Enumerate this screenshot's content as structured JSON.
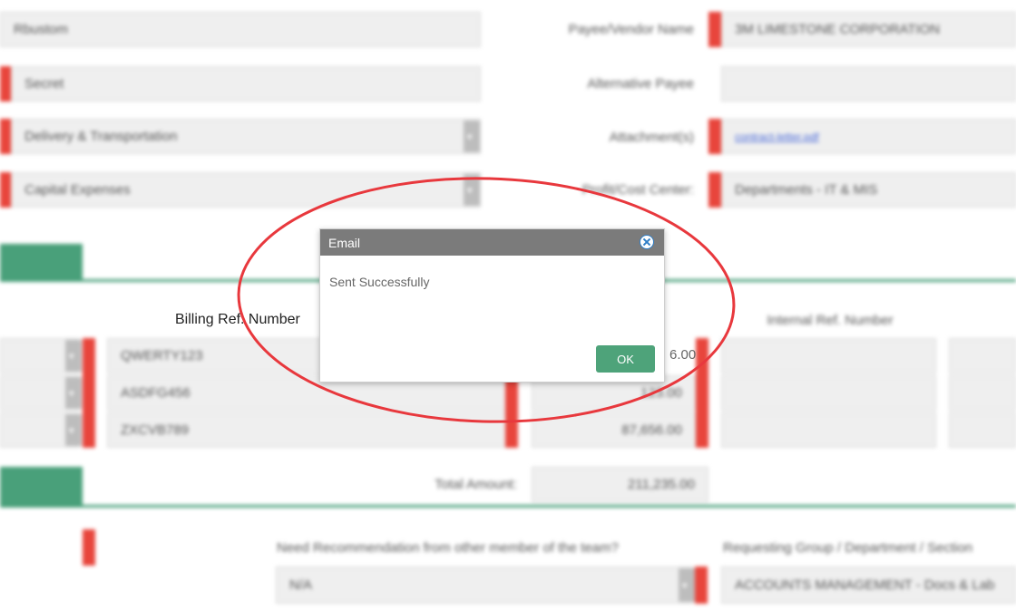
{
  "form": {
    "fields": {
      "left1": "Rbustom",
      "left2": "Secret",
      "left3": "Delivery & Transportation",
      "left4": "Capital Expenses",
      "payee_label": "Payee/Vendor Name",
      "payee_value": "3M LIMESTONE CORPORATION",
      "alt_payee_label": "Alternative Payee",
      "attachments_label": "Attachment(s)",
      "attachments_value": "contract-letter.pdf",
      "cost_center_label": "Profit/Cost Center:",
      "cost_center_value": "Departments - IT & MIS"
    },
    "billing": {
      "billing_ref_label": "Billing Ref. Number",
      "internal_ref_label": "Internal Ref. Number",
      "rows": [
        {
          "ref": "QWERTY123",
          "amount": "6.00"
        },
        {
          "ref": "ASDFG456",
          "amount": "123.00"
        },
        {
          "ref": "ZXCVB789",
          "amount": "87,656.00"
        }
      ],
      "total_label": "Total Amount:",
      "total_value": "211,235.00"
    },
    "bottom": {
      "recommend_label": "Need Recommendation from other member of the team?",
      "recommend_value": "N/A",
      "group_label": "Requesting Group / Department / Section",
      "group_value": "ACCOUNTS MANAGEMENT - Docs & Lab"
    }
  },
  "dialog": {
    "title": "Email",
    "message": "Sent Successfully",
    "ok_label": "OK"
  },
  "colors": {
    "accent_green": "#49a07a",
    "required_red": "#e8453c",
    "annotation_red": "#e8383d"
  }
}
